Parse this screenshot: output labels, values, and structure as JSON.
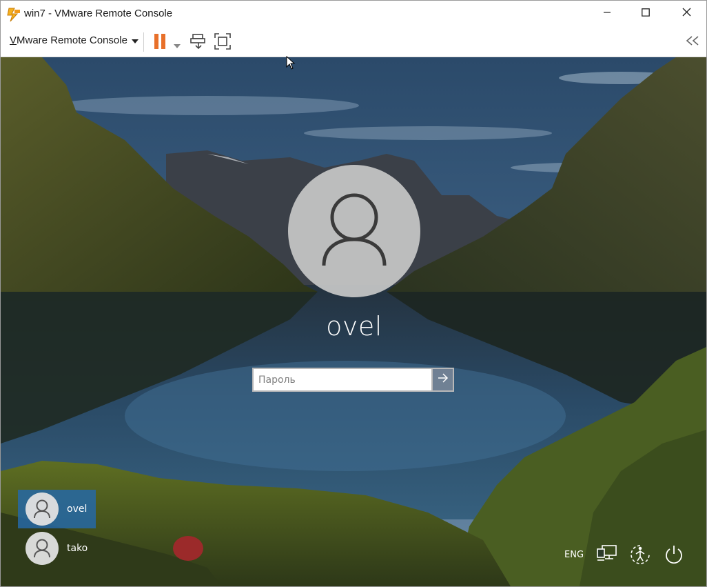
{
  "window": {
    "title": "win7 - VMware Remote Console"
  },
  "toolbar": {
    "menu_label_first": "V",
    "menu_label_rest": "Mware Remote Console",
    "pause_color": "#e8702a"
  },
  "login": {
    "username": "ovel",
    "password_placeholder": "Пароль"
  },
  "users": [
    {
      "name": "ovel",
      "selected": true
    },
    {
      "name": "tako",
      "selected": false
    }
  ],
  "system": {
    "language": "ENG"
  },
  "icons": {
    "app": "vmware-logo-icon",
    "minimize": "minimize-icon",
    "maximize": "maximize-icon",
    "close": "close-icon",
    "menu_dropdown": "chevron-down-icon",
    "pause": "pause-icon",
    "pause_dropdown": "chevron-down-icon",
    "send_ctrl_alt_del": "send-keys-icon",
    "fullscreen": "fullscreen-icon",
    "collapse": "double-chevron-left-icon",
    "avatar": "user-avatar-icon",
    "submit": "arrow-right-icon",
    "network": "network-icon",
    "ease_of_access": "ease-of-access-icon",
    "power": "power-icon"
  }
}
